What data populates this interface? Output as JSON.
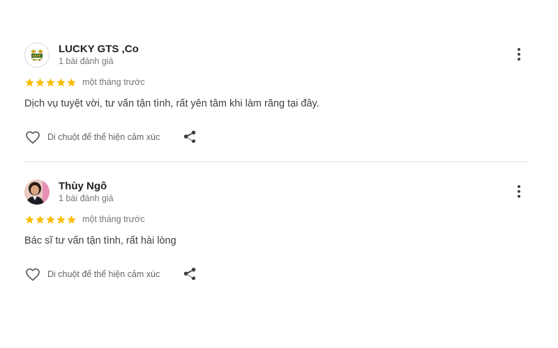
{
  "reviews": [
    {
      "author": "LUCKY GTS ,Co",
      "review_count": "1 bài đánh giá",
      "rating": 5,
      "time": "một tháng trước",
      "text": "Dịch vụ tuyệt vời, tư vấn tận tình, rất yên tâm khi làm răng tại đây.",
      "react_label": "Di chuột để thể hiện cảm xúc",
      "avatar_icon": "lucky-gts-logo"
    },
    {
      "author": "Thùy Ngô",
      "review_count": "1 bài đánh giá",
      "rating": 5,
      "time": "một tháng trước",
      "text": "Bác sĩ tư vấn tận tình, rất hài lòng",
      "react_label": "Di chuột để thể hiện cảm xúc",
      "avatar_icon": "profile-photo"
    }
  ],
  "colors": {
    "star": "#fbbc04",
    "icon": "#5f6368",
    "divider": "#dadce0"
  },
  "icons": {
    "more": "more-vert-icon",
    "heart": "heart-outline-icon",
    "share": "share-icon",
    "star": "star-icon"
  }
}
